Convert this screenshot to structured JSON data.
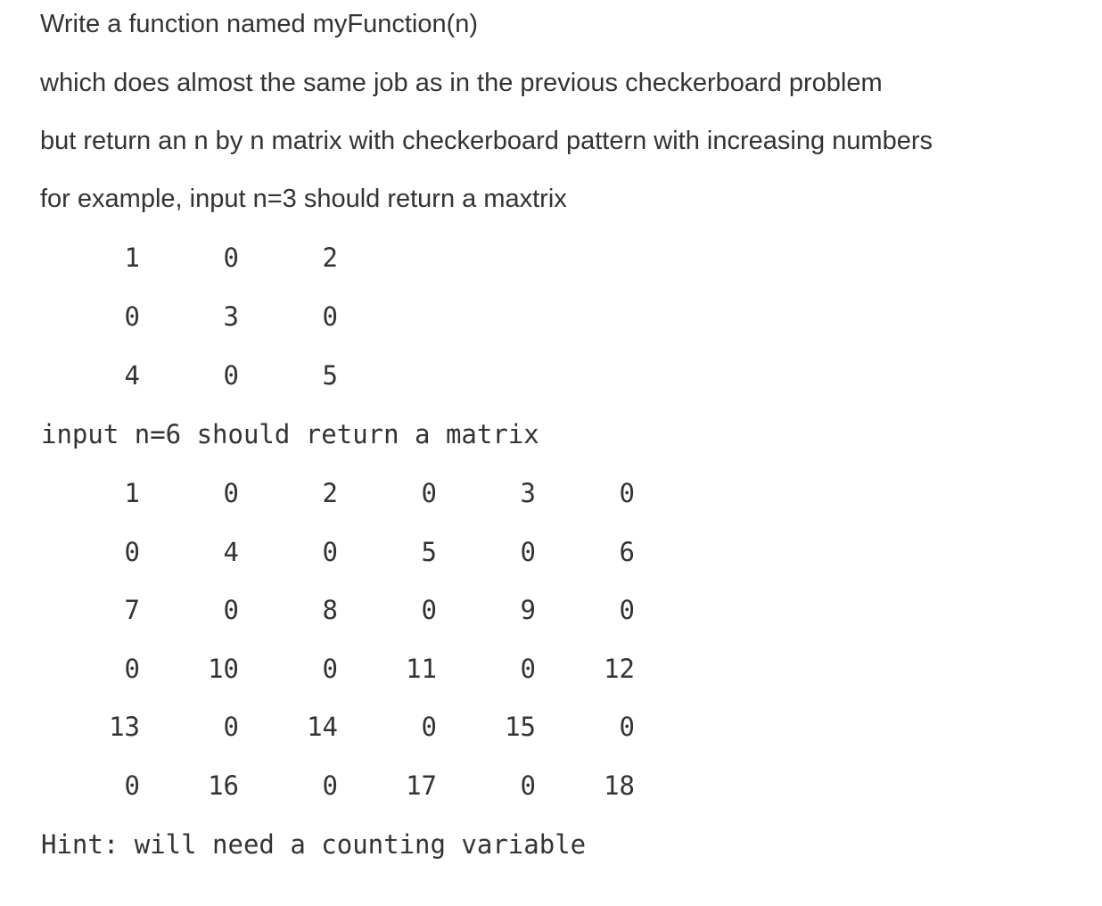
{
  "intro_lines": [
    "Write a function named myFunction(n)",
    "which does almost the same job as in the previous checkerboard problem",
    "but return an n by n matrix with checkerboard pattern with increasing numbers",
    "for example, input n=3 should return a maxtrix"
  ],
  "example_3": {
    "n": 3,
    "rows": [
      [
        "1",
        "0",
        "2"
      ],
      [
        "0",
        "3",
        "0"
      ],
      [
        "4",
        "0",
        "5"
      ]
    ]
  },
  "example_6_label": "input n=6 should return a matrix",
  "example_6": {
    "n": 6,
    "rows": [
      [
        "1",
        "0",
        "2",
        "0",
        "3",
        "0"
      ],
      [
        "0",
        "4",
        "0",
        "5",
        "0",
        "6"
      ],
      [
        "7",
        "0",
        "8",
        "0",
        "9",
        "0"
      ],
      [
        "0",
        "10",
        "0",
        "11",
        "0",
        "12"
      ],
      [
        "13",
        "0",
        "14",
        "0",
        "15",
        "0"
      ],
      [
        "0",
        "16",
        "0",
        "17",
        "0",
        "18"
      ]
    ]
  },
  "hint": "Hint: will need a counting variable"
}
